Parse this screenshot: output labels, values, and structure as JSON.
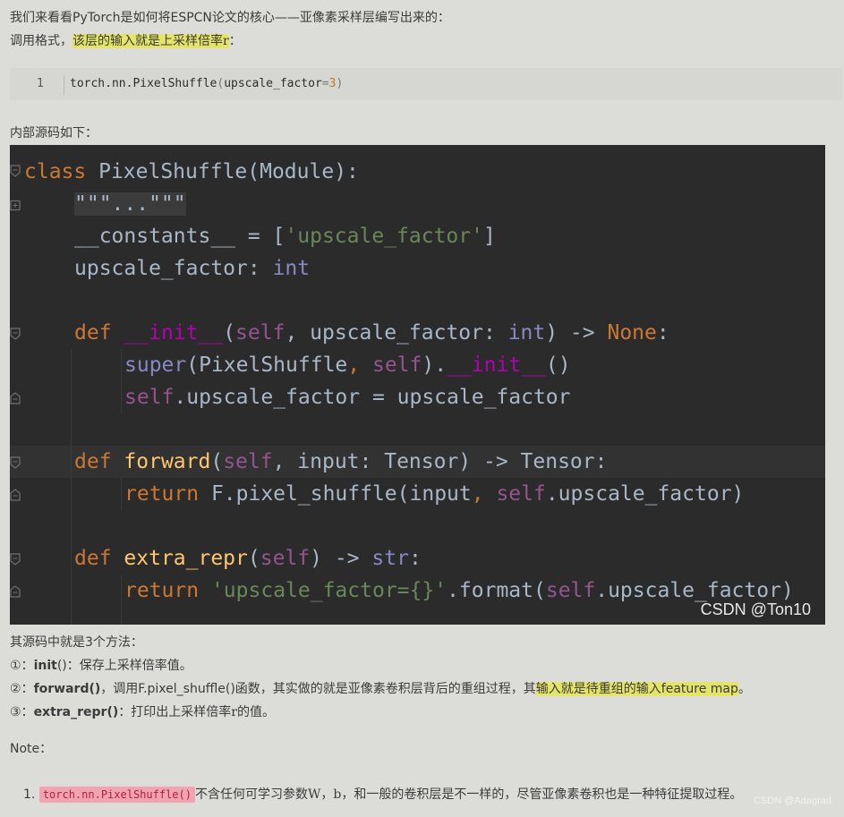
{
  "intro": {
    "line1": "我们来看看PyTorch是如何将ESPCN论文的核心——亚像素采样层编写出来的：",
    "line2_prefix": "调用格式，",
    "line2_highlight": "该层的输入就是上采样倍率",
    "line2_var": "r",
    "line2_suffix": "："
  },
  "snippet": {
    "line_number": "1",
    "code_call": "torch.nn.PixelShuffle",
    "code_paren_open": "(",
    "code_arg": "upscale_factor",
    "code_eq": "=",
    "code_value": "3",
    "code_paren_close": ")"
  },
  "source_label": "内部源码如下：",
  "editor": {
    "watermark": "CSDN @Ton10",
    "l1": {
      "kw": "class",
      "rest": " PixelShuffle(Module):"
    },
    "l2": {
      "docs": "\"\"\"...\"\"\""
    },
    "l3": {
      "a": "__constants__ = [",
      "s": "'upscale_factor'",
      "b": "]"
    },
    "l4": {
      "a": "upscale_factor: ",
      "t": "int"
    },
    "l6": {
      "kw": "def",
      "sp": " ",
      "magic": "__init__",
      "p1": "(",
      "self": "self",
      "c1": ", upscale_factor: ",
      "t": "int",
      "p2": ") -> ",
      "none": "None",
      "end": ":"
    },
    "l7": {
      "bi": "super",
      "a": "(PixelShuffle",
      "comma": ", ",
      "self": "self",
      "b": ").",
      "magic": "__init__",
      "c": "()"
    },
    "l8": {
      "self": "self",
      "rest": ".upscale_factor = upscale_factor"
    },
    "l10": {
      "kw": "def",
      "sp": " ",
      "fn": "forward",
      "p1": "(",
      "self": "self",
      "rest": ", input: Tensor) -> Tensor:"
    },
    "l11": {
      "kw": "return",
      "a": " F.pixel_shuffle(input",
      "comma": ", ",
      "self": "self",
      "b": ".upscale_factor)"
    },
    "l13": {
      "kw": "def",
      "sp": " ",
      "fn": "extra_repr",
      "p1": "(",
      "self": "self",
      "p2": ") -> ",
      "t": "str",
      "end": ":"
    },
    "l14": {
      "kw": "return",
      "sp": " ",
      "s": "'upscale_factor={}'",
      "a": ".format(",
      "self": "self",
      "b": ".upscale_factor)"
    }
  },
  "methods": {
    "heading": "其源码中就是3个方法：",
    "m1": {
      "num": "①：",
      "name": "init",
      "rest": "()：保存上采样倍率值。"
    },
    "m2": {
      "num": "②：",
      "name": "forward()",
      "rest": "，调用F.pixel_shuffle()函数，其实做的就是亚像素卷积层背后的重组过程，其",
      "highlight": "输入就是待重组的输入feature map",
      "end": "。"
    },
    "m3": {
      "num": "③：",
      "name": "extra_repr()",
      "rest": "：打印出上采样倍率",
      "var": "r",
      "end": "的值。"
    }
  },
  "note": {
    "label": "Note：",
    "item_num": "1.",
    "code": "torch.nn.PixelShuffle()",
    "text_a": "不含任何可学习参数",
    "var_w": "W",
    "sep": "，",
    "var_b": "b",
    "text_b": "，和一般的卷积层是不一样的，尽管亚像素卷积也是一种特征提取过程。"
  },
  "footer_watermark": "CSDN @Adagrad"
}
